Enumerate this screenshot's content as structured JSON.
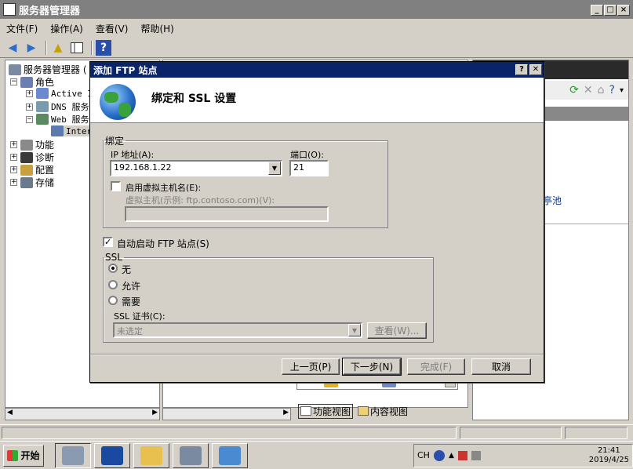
{
  "window": {
    "title": "服务器管理器",
    "menu": [
      "文件(F)",
      "操作(A)",
      "查看(V)",
      "帮助(H)"
    ]
  },
  "tree": {
    "items": [
      {
        "label": "服务器管理器 (",
        "level": 0,
        "expander": ""
      },
      {
        "label": "角色",
        "level": 1,
        "expander": "−"
      },
      {
        "label": "Active I",
        "level": 2,
        "expander": "+"
      },
      {
        "label": "DNS 服务",
        "level": 2,
        "expander": "+"
      },
      {
        "label": "Web 服务",
        "level": 2,
        "expander": "−"
      },
      {
        "label": "Inter",
        "level": 3,
        "expander": ""
      },
      {
        "label": "功能",
        "level": 1,
        "expander": "+"
      },
      {
        "label": "诊断",
        "level": 1,
        "expander": "+"
      },
      {
        "label": "配置",
        "level": 1,
        "expander": "+"
      },
      {
        "label": "存储",
        "level": 1,
        "expander": "+"
      }
    ]
  },
  "right_pane": {
    "link_text": "亭池"
  },
  "view_tabs": [
    "功能视图",
    "内容视图"
  ],
  "dialog": {
    "title": "添加 FTP 站点",
    "help_btn": "?",
    "close_btn": "✕",
    "heading": "绑定和 SSL 设置",
    "binding": {
      "legend": "绑定",
      "ip_label": "IP 地址(A):",
      "ip_value": "192.168.1.22",
      "port_label": "端口(O):",
      "port_value": "21",
      "vhost_checkbox": "启用虚拟主机名(E):",
      "vhost_label": "虚拟主机(示例: ftp.contoso.com)(V):",
      "vhost_value": ""
    },
    "autostart": "自动启动 FTP 站点(S)",
    "ssl": {
      "legend": "SSL",
      "options": [
        "无",
        "允许",
        "需要"
      ],
      "selected": 0,
      "cert_label": "SSL 证书(C):",
      "cert_value": "未选定",
      "view_btn": "查看(W)..."
    },
    "buttons": {
      "prev": "上一页(P)",
      "next": "下一步(N)",
      "finish": "完成(F)",
      "cancel": "取消"
    }
  },
  "taskbar": {
    "start": "开始",
    "lang": "CH",
    "time": "21:41",
    "date": "2019/4/25"
  },
  "colors": {
    "dialog_title": "#0a246a",
    "window_title": "#808080",
    "face": "#d4d0c8"
  }
}
